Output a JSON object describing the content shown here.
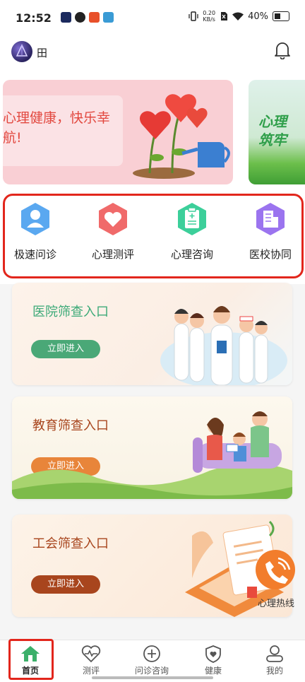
{
  "status_bar": {
    "time": "12:52",
    "net_speed_value": "0.20",
    "net_speed_unit": "KB/s",
    "battery": "40%"
  },
  "header": {
    "username": "田"
  },
  "banner": {
    "slide1_text_line1": "心理健康，快乐幸",
    "slide1_text_line2": "航!",
    "slide2_text_line1": "心理",
    "slide2_text_line2": "筑牢"
  },
  "quick_actions": [
    {
      "label": "极速问诊",
      "icon": "doctor-icon",
      "color": "#5aa8f0"
    },
    {
      "label": "心理测评",
      "icon": "heart-icon",
      "color": "#f06a6a"
    },
    {
      "label": "心理咨询",
      "icon": "clipboard-icon",
      "color": "#3ccf9a"
    },
    {
      "label": "医校协同",
      "icon": "building-icon",
      "color": "#9b74ef"
    }
  ],
  "cards": [
    {
      "title": "医院筛查入口",
      "button": "立即进入",
      "title_color": "#3daa78",
      "button_color": "#4aa877"
    },
    {
      "title": "教育筛查入口",
      "button": "立即进入",
      "title_color": "#a8451d",
      "button_color": "#e8853a"
    },
    {
      "title": "工会筛查入口",
      "button": "立即进入",
      "title_color": "#a8451d",
      "button_color": "#a8451d"
    }
  ],
  "hotline": {
    "label": "心理热线"
  },
  "tabbar": {
    "items": [
      {
        "label": "首页",
        "icon": "home-icon"
      },
      {
        "label": "测评",
        "icon": "heartbeat-icon"
      },
      {
        "label": "问诊咨询",
        "icon": "plus-circle-icon"
      },
      {
        "label": "健康",
        "icon": "shield-heart-icon"
      },
      {
        "label": "我的",
        "icon": "user-icon"
      }
    ]
  }
}
